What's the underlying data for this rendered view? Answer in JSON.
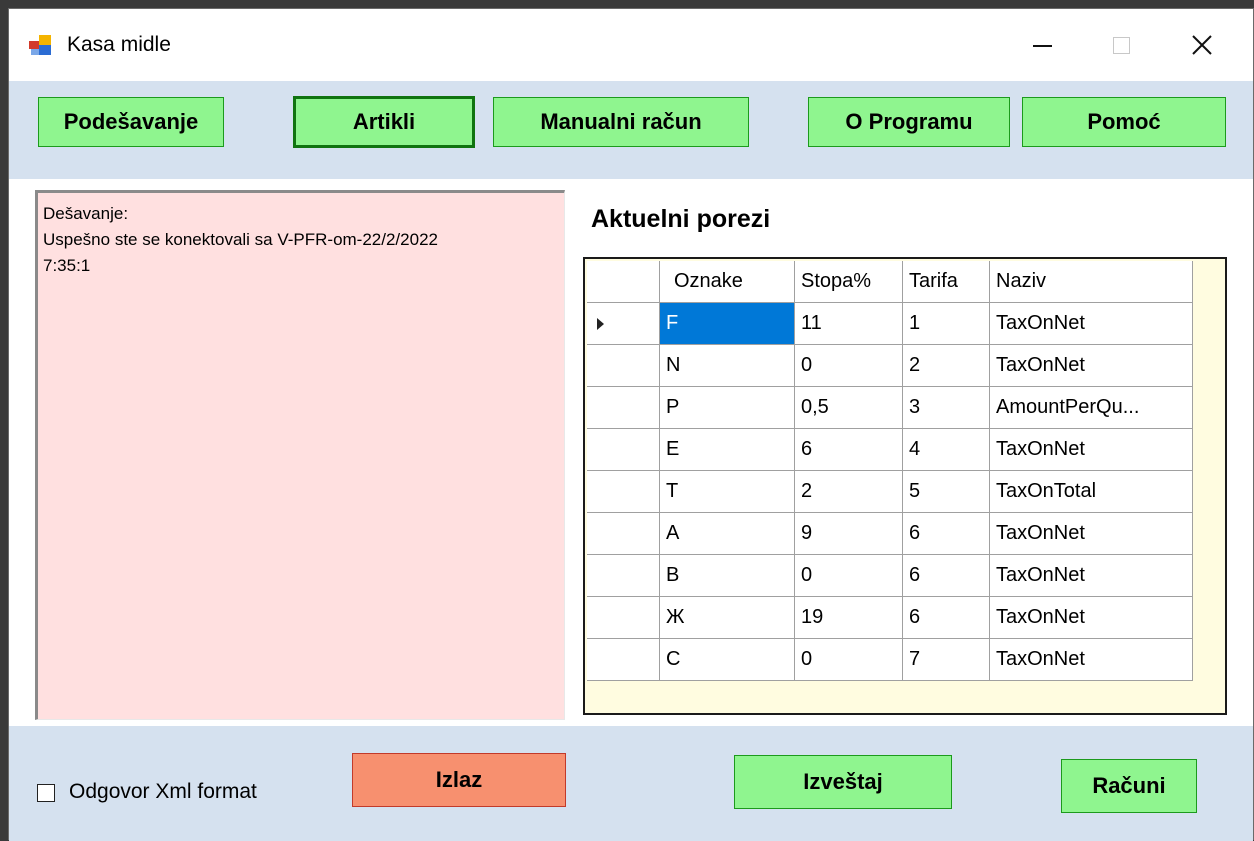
{
  "window": {
    "title": "Kasa midle"
  },
  "toolbar": {
    "settings": "Podešavanje",
    "items": "Artikli",
    "manual_receipt": "Manualni račun",
    "about": "O Programu",
    "help": "Pomoć"
  },
  "log": {
    "lines": [
      "Dešavanje:",
      "Uspešno ste se konektovali sa V-PFR-om-22/2/2022",
      "7:35:1"
    ]
  },
  "taxes": {
    "title": "Aktuelni porezi",
    "columns": [
      "Oznake",
      "Stopa%",
      "Tarifa",
      "Naziv"
    ],
    "rows": [
      [
        "F",
        "11",
        "1",
        "TaxOnNet"
      ],
      [
        "N",
        "0",
        "2",
        "TaxOnNet"
      ],
      [
        "P",
        "0,5",
        "3",
        "AmountPerQu..."
      ],
      [
        "E",
        "6",
        "4",
        "TaxOnNet"
      ],
      [
        "T",
        "2",
        "5",
        "TaxOnTotal"
      ],
      [
        "A",
        "9",
        "6",
        "TaxOnNet"
      ],
      [
        "B",
        "0",
        "6",
        "TaxOnNet"
      ],
      [
        "Ж",
        "19",
        "6",
        "TaxOnNet"
      ],
      [
        "C",
        "0",
        "7",
        "TaxOnNet"
      ]
    ],
    "selected_row": 0
  },
  "footer": {
    "xml_checkbox_label": "Odgovor Xml format",
    "xml_checked": false,
    "exit": "Izlaz",
    "report": "Izveštaj",
    "receipts": "Računi"
  },
  "colors": {
    "button_green": "#8ff58f",
    "button_red": "#f7906f",
    "panel_blue": "#d5e1ef",
    "log_pink": "#ffe0e0",
    "selection": "#0078d7"
  }
}
